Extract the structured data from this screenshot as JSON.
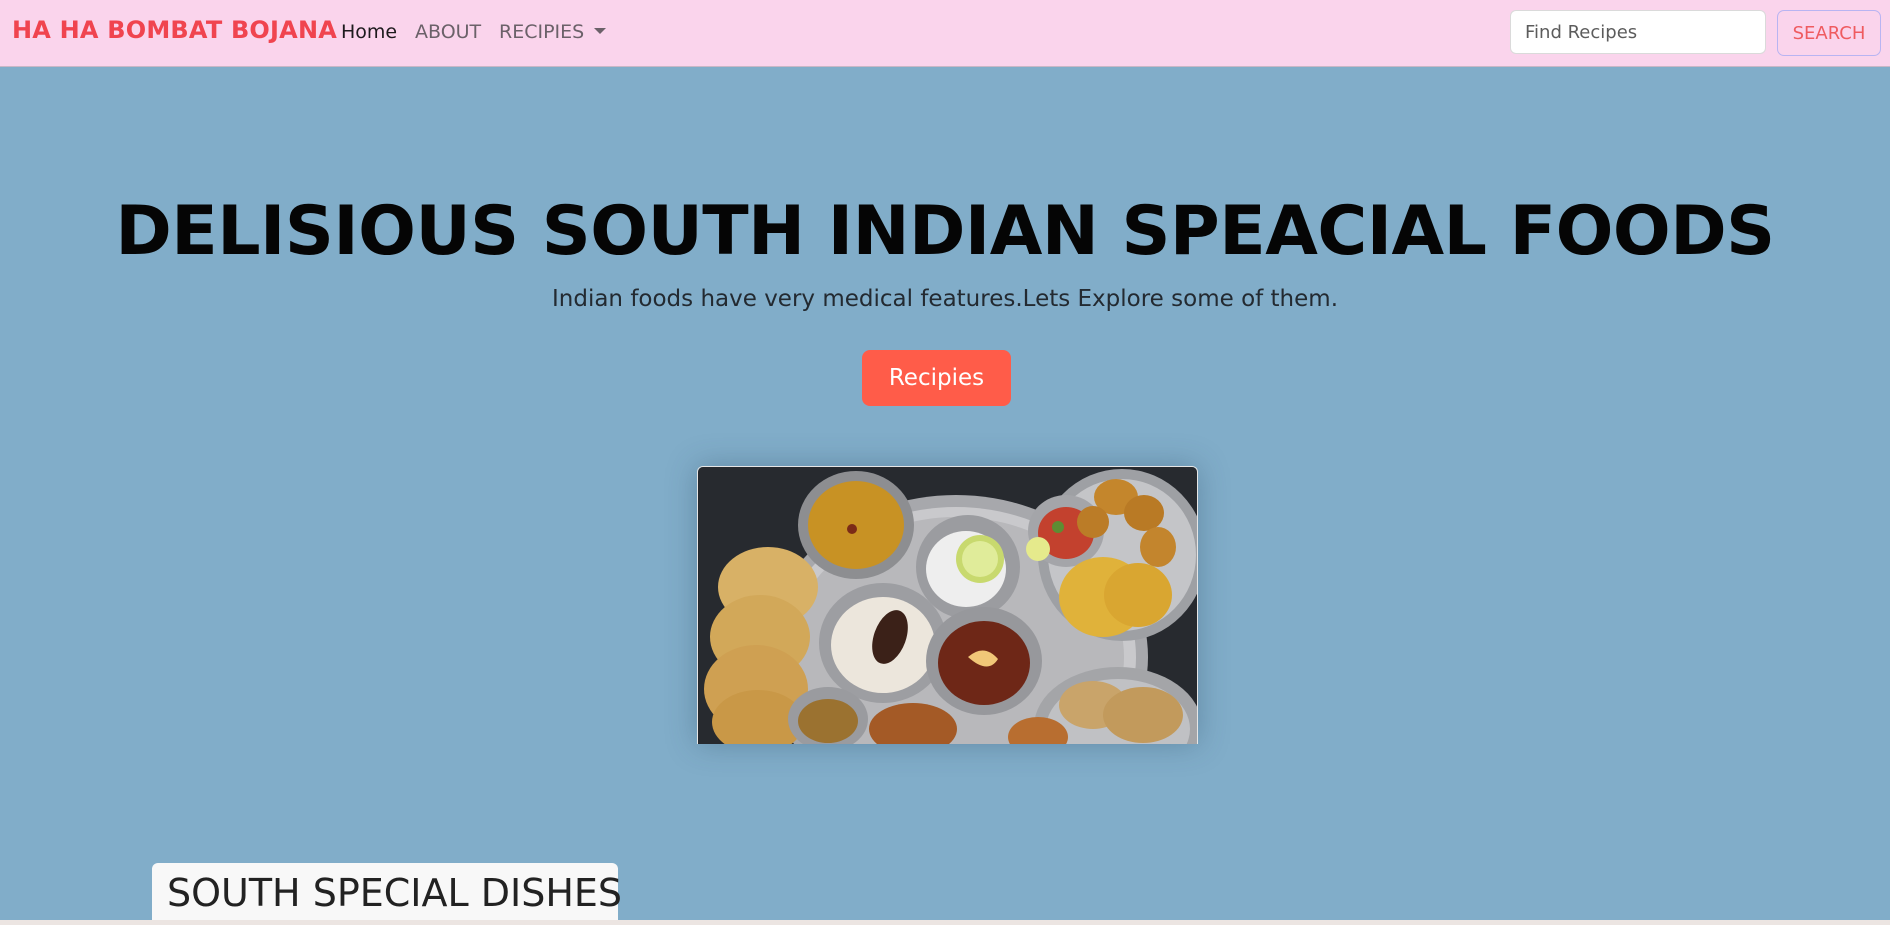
{
  "navbar": {
    "brand": "HA HA BOMBAT BOJANA",
    "links": [
      "Home",
      "ABOUT",
      "RECIPIES"
    ],
    "active_link": "Home",
    "search_placeholder": "Find Recipes",
    "search_button": "SEARCH",
    "background": "#fad4ec",
    "brand_color": "#f0444f"
  },
  "hero": {
    "title": "DELISIOUS SOUTH INDIAN SPEACIAL FOODS",
    "subtitle": "Indian foods have very medical features.Lets Explore some of them.",
    "button_label": "Recipies",
    "button_color": "#ff5c49",
    "background": "#81adc9"
  },
  "section": {
    "heading": "SOUTH SPECIAL DISHES"
  }
}
